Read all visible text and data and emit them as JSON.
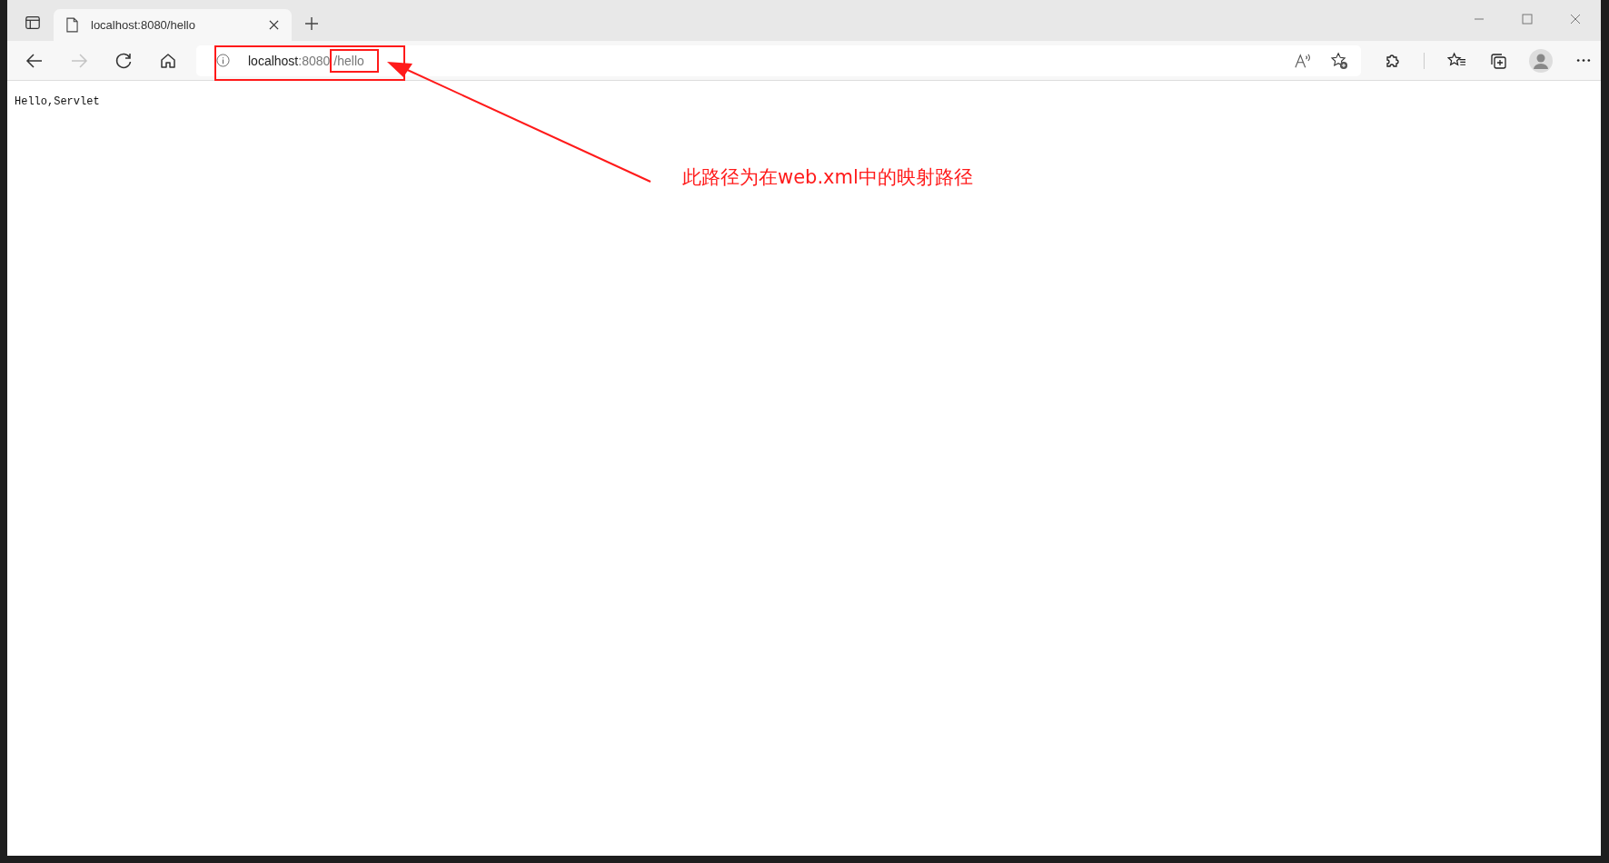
{
  "tab": {
    "title": "localhost:8080/hello",
    "selected": true
  },
  "nav_buttons": [
    {
      "kind": "back",
      "disabled": false
    },
    {
      "kind": "forward",
      "disabled": true
    },
    {
      "kind": "reload",
      "disabled": false
    },
    {
      "kind": "home",
      "disabled": false
    }
  ],
  "address_bar": {
    "host": "localhost",
    "port": ":8080",
    "path": "/hello"
  },
  "page": {
    "text": "Hello,Servlet"
  },
  "annotation": {
    "text": "此路径为在web.xml中的映射路径"
  }
}
